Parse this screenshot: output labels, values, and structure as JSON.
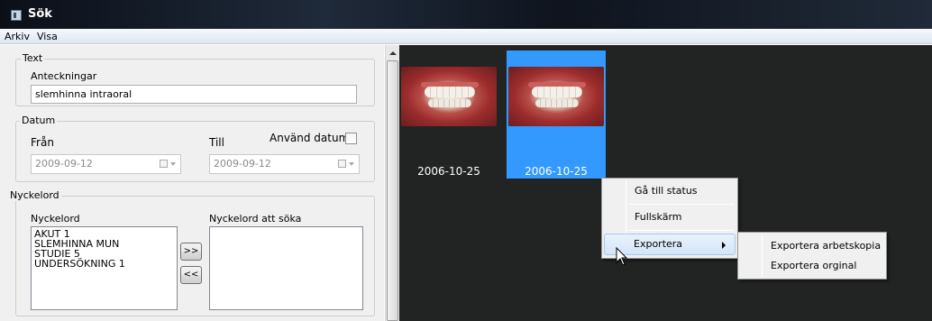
{
  "window": {
    "title": "Sök",
    "app_icon": "app-icon"
  },
  "menubar": {
    "items": [
      "Arkiv",
      "Visa"
    ]
  },
  "text_group": {
    "title": "Text",
    "notes_label": "Anteckningar",
    "notes_value": "slemhinna intraoral"
  },
  "date_group": {
    "title": "Datum",
    "from_label": "Från",
    "to_label": "Till",
    "use_date_label": "Använd datum",
    "use_date_checked": false,
    "from_value": "2009-09-12",
    "to_value": "2009-09-12"
  },
  "keyword_group": {
    "title": "Nyckelord",
    "list_label": "Nyckelord",
    "search_label": "Nyckelord att söka",
    "keywords": [
      "AKUT 1",
      "SLEMHINNA MUN",
      "STUDIE 5",
      "UNDERSÖKNING 1"
    ],
    "search_keywords": [],
    "add_button": ">>",
    "remove_button": "<<"
  },
  "thumbnails": [
    {
      "date": "2006-10-25",
      "selected": false
    },
    {
      "date": "2006-10-25",
      "selected": true
    }
  ],
  "context_menu": {
    "items": [
      "Gå till status",
      "Fullskärm",
      "Exportera"
    ],
    "highlighted": "Exportera"
  },
  "submenu": {
    "items": [
      "Exportera arbetskopia",
      "Exportera orginal"
    ]
  },
  "colors": {
    "selection": "#3399ff",
    "viewer_background": "#222323",
    "panel_background": "#f0f0f0"
  }
}
